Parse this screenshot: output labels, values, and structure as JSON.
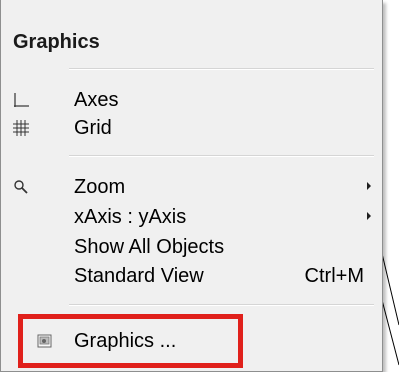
{
  "menu": {
    "title": "Graphics",
    "items": [
      {
        "label": "Axes",
        "icon": "axes-icon"
      },
      {
        "label": "Grid",
        "icon": "grid-icon"
      },
      {
        "label": "Zoom",
        "icon": "zoom-icon",
        "submenu": true
      },
      {
        "label": "xAxis : yAxis",
        "submenu": true
      },
      {
        "label": "Show All Objects"
      },
      {
        "label": "Standard View",
        "shortcut": "Ctrl+M"
      },
      {
        "label": "Graphics ...",
        "icon": "graphics-settings-icon"
      }
    ]
  },
  "colors": {
    "menu_background": "#f0f0f0",
    "highlight_border": "#e0201b"
  }
}
